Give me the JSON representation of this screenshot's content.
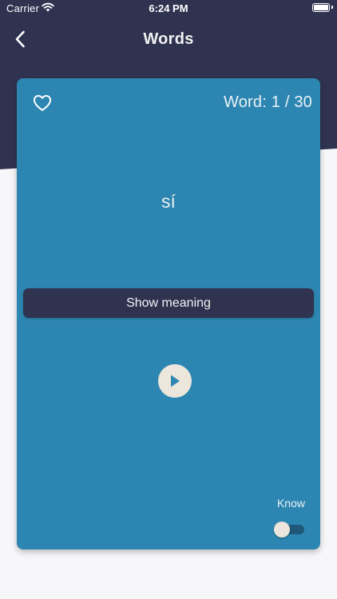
{
  "status_bar": {
    "carrier": "Carrier",
    "time": "6:24 PM",
    "battery_level": 1.0
  },
  "nav": {
    "title": "Words",
    "back_icon": "chevron-left-icon"
  },
  "card": {
    "favorite_icon": "heart-outline-icon",
    "counter_label": "Word: 1 / 30",
    "word": "sí",
    "show_meaning_label": "Show meaning",
    "play_icon": "play-icon",
    "know_label": "Know",
    "know_toggle_on": false
  },
  "colors": {
    "header": "#2f3350",
    "card": "#2d86b1",
    "button": "#2f3350",
    "accent_light": "#ece6dc",
    "page_background": "#f7f7f9"
  }
}
